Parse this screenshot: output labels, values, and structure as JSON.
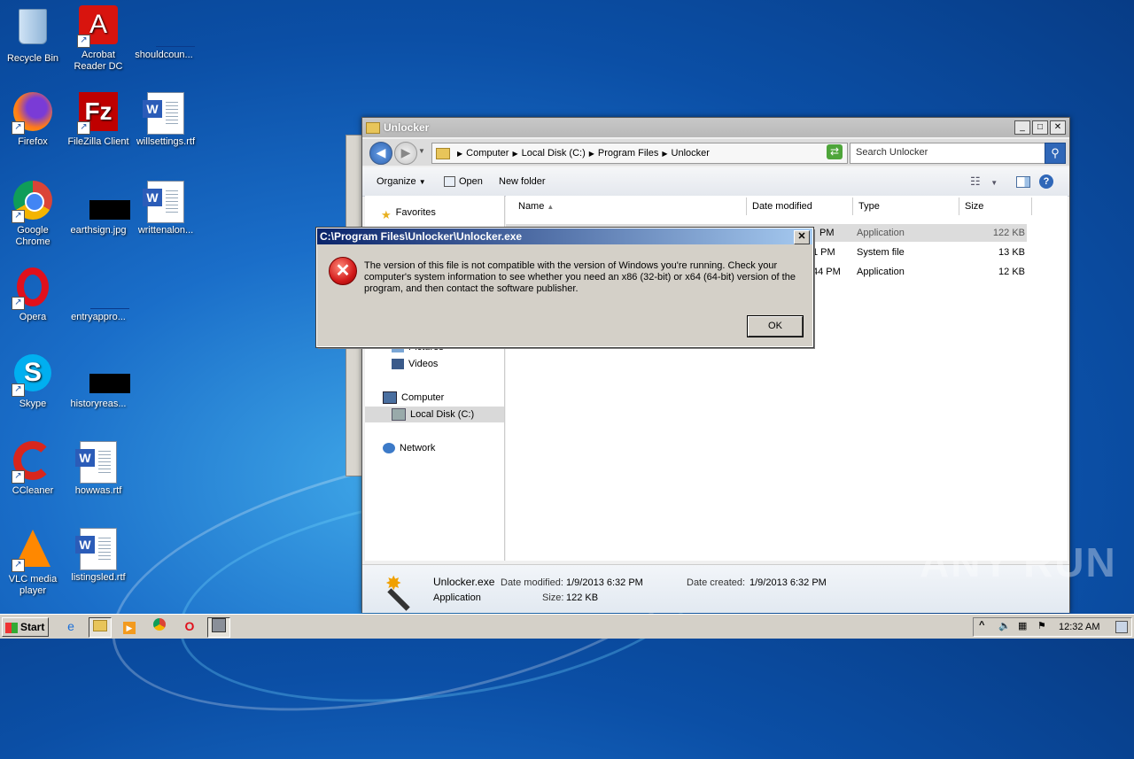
{
  "desktop": {
    "icons": [
      {
        "label": "Recycle Bin",
        "icon": "recycle-bin-icon"
      },
      {
        "label": "Acrobat Reader DC",
        "icon": "acrobat-icon"
      },
      {
        "label": "shouldcoun...",
        "icon": "blank-file-icon"
      },
      {
        "label": "Firefox",
        "icon": "firefox-icon"
      },
      {
        "label": "FileZilla Client",
        "icon": "filezilla-icon"
      },
      {
        "label": "willsettings.rtf",
        "icon": "word-doc-icon"
      },
      {
        "label": "Google Chrome",
        "icon": "chrome-icon"
      },
      {
        "label": "earthsign.jpg",
        "icon": "image-file-icon"
      },
      {
        "label": "writtenalon...",
        "icon": "word-doc-icon"
      },
      {
        "label": "Opera",
        "icon": "opera-icon"
      },
      {
        "label": "entryappro...",
        "icon": "blank-file-icon"
      },
      {
        "label": "Skype",
        "icon": "skype-icon"
      },
      {
        "label": "historyreas...",
        "icon": "image-file-icon"
      },
      {
        "label": "CCleaner",
        "icon": "ccleaner-icon"
      },
      {
        "label": "howwas.rtf",
        "icon": "word-doc-icon"
      },
      {
        "label": "VLC media player",
        "icon": "vlc-icon"
      },
      {
        "label": "listingsled.rtf",
        "icon": "word-doc-icon"
      }
    ]
  },
  "explorer": {
    "title": "Unlocker",
    "breadcrumb": [
      "Computer",
      "Local Disk (C:)",
      "Program Files",
      "Unlocker"
    ],
    "search_placeholder": "Search Unlocker",
    "toolbar": {
      "organize": "Organize",
      "open": "Open",
      "new_folder": "New folder"
    },
    "nav": {
      "favorites": "Favorites",
      "pictures": "Pictures",
      "videos": "Videos",
      "computer": "Computer",
      "local_disk": "Local Disk (C:)",
      "network": "Network"
    },
    "columns": {
      "name": "Name",
      "date_modified": "Date modified",
      "type": "Type",
      "size": "Size"
    },
    "rows": [
      {
        "date": "PM",
        "type": "Application",
        "size": "122 KB"
      },
      {
        "date": "1 PM",
        "type": "System file",
        "size": "13 KB"
      },
      {
        "date": "44 PM",
        "type": "Application",
        "size": "12 KB"
      }
    ],
    "details": {
      "filename": "Unlocker.exe",
      "date_modified_label": "Date modified:",
      "date_modified": "1/9/2013 6:32 PM",
      "date_created_label": "Date created:",
      "date_created": "1/9/2013 6:32 PM",
      "type": "Application",
      "size_label": "Size:",
      "size": "122 KB"
    }
  },
  "dialog": {
    "title": "C:\\Program Files\\Unlocker\\Unlocker.exe",
    "message": "The version of this file is not compatible with the version of Windows you're running. Check your computer's system information to see whether you need an x86 (32-bit) or x64 (64-bit) version of the program, and then contact the software publisher.",
    "ok": "OK"
  },
  "taskbar": {
    "start": "Start",
    "clock": "12:32 AM"
  },
  "watermark": "ANY RUN"
}
